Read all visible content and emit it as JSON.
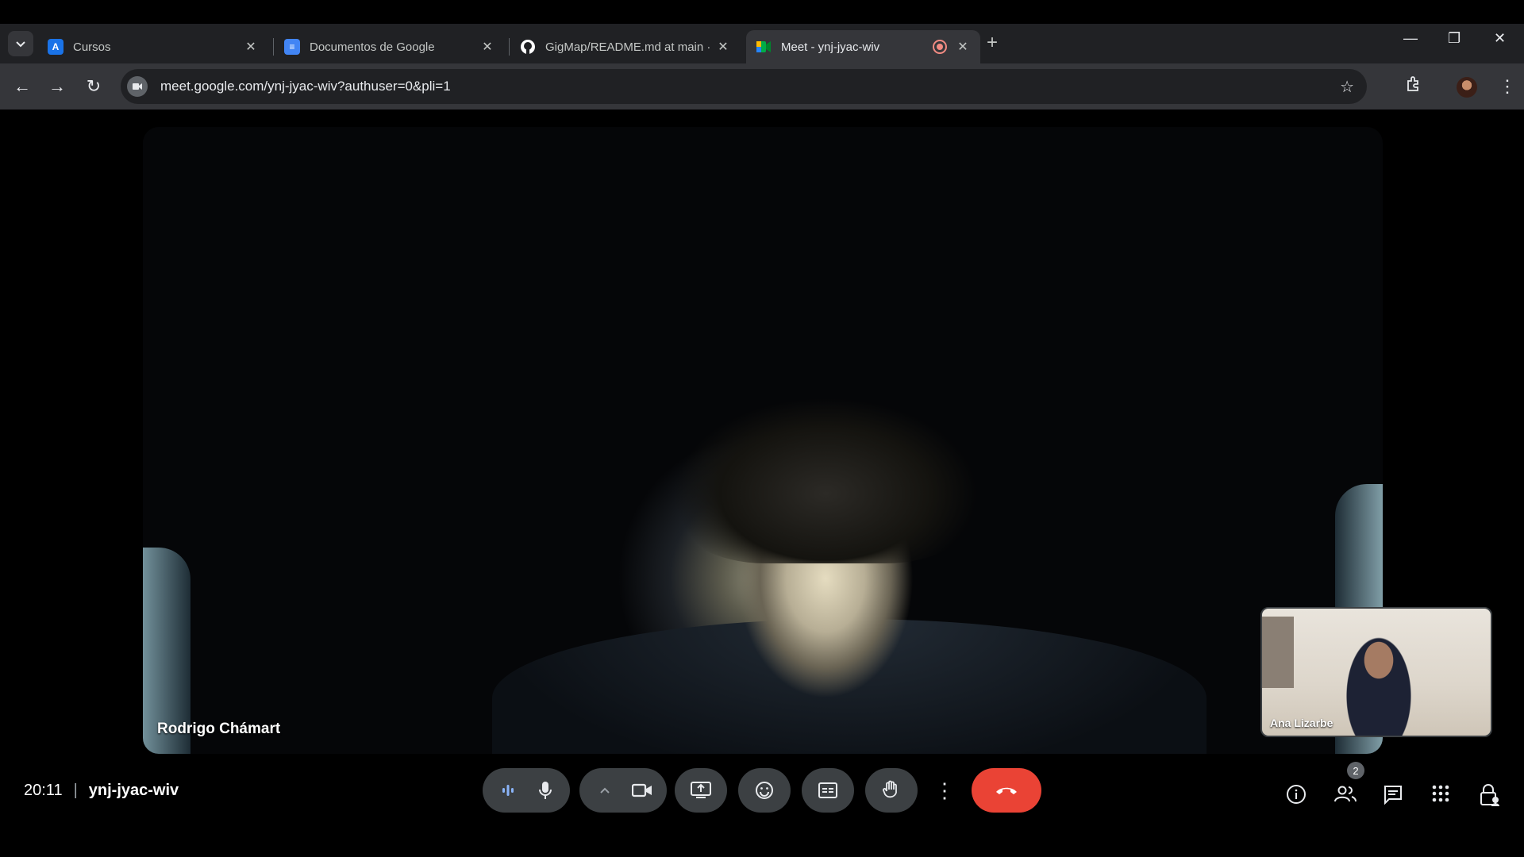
{
  "browser": {
    "tabs": [
      {
        "title": "Cursos",
        "favicon": "A",
        "favicon_color": "#1a73e8"
      },
      {
        "title": "Documentos de Google",
        "favicon": "≡",
        "favicon_color": "#4285f4"
      },
      {
        "title": "GigMap/README.md at main ·",
        "favicon": "github",
        "favicon_color": "#ffffff"
      },
      {
        "title": "Meet - ynj-jyac-wiv",
        "favicon": "meet",
        "favicon_color": "#00ac47",
        "active": true
      }
    ],
    "tab_close_glyph": "✕",
    "new_tab_glyph": "+",
    "window_controls": {
      "minimize": "—",
      "restore": "❐",
      "close": "✕"
    },
    "url": "meet.google.com/ynj-jyac-wiv?authuser=0&pli=1",
    "nav": {
      "back": "←",
      "forward": "→",
      "reload": "↻"
    }
  },
  "meet": {
    "main_participant": "Rodrigo Chámart",
    "pip_participant": "Ana Lizarbe",
    "time": "20:11",
    "separator": "|",
    "meeting_code": "ynj-jyac-wiv",
    "participant_count": "2",
    "colors": {
      "end_call": "#ea4335",
      "control_bg": "#3c4043",
      "background": "#000000"
    }
  }
}
